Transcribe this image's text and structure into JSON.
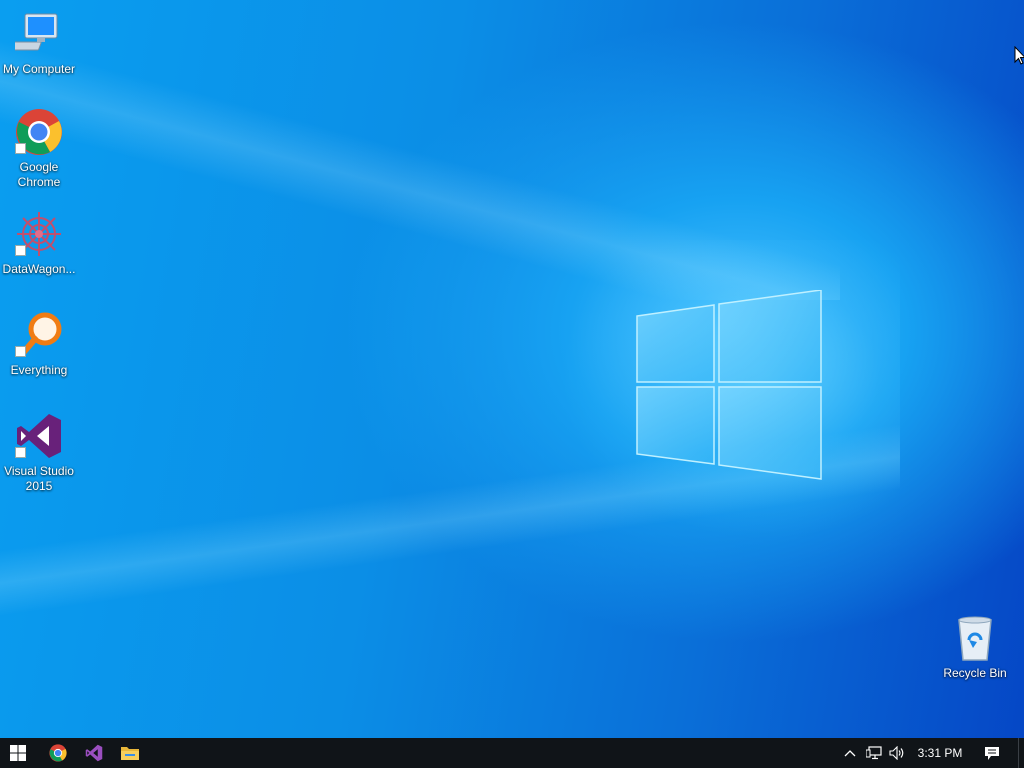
{
  "desktop": {
    "icons": [
      {
        "label": "My Computer",
        "icon": "computer-icon"
      },
      {
        "label": "Google Chrome",
        "icon": "chrome-icon"
      },
      {
        "label": "DataWagon...",
        "icon": "datawagon-icon"
      },
      {
        "label": "Everything",
        "icon": "everything-search-icon"
      },
      {
        "label": "Visual Studio 2015",
        "icon": "visual-studio-icon"
      },
      {
        "label": "Recycle Bin",
        "icon": "recycle-bin-icon"
      }
    ],
    "colors": {
      "wallpaper_light": "#4cc3ff",
      "wallpaper_dark": "#0547c6"
    }
  },
  "taskbar": {
    "pinned": [
      {
        "name": "Start",
        "icon": "windows-start-icon"
      },
      {
        "name": "Google Chrome",
        "icon": "chrome-icon"
      },
      {
        "name": "Visual Studio",
        "icon": "visual-studio-icon"
      },
      {
        "name": "File Explorer",
        "icon": "folder-icon"
      }
    ],
    "tray": {
      "icons": [
        "chevron-up-icon",
        "network-icon",
        "volume-icon"
      ],
      "clock": "3:31 PM",
      "action_center_icon": "notification-icon"
    },
    "colors": {
      "background": "#101418"
    }
  }
}
